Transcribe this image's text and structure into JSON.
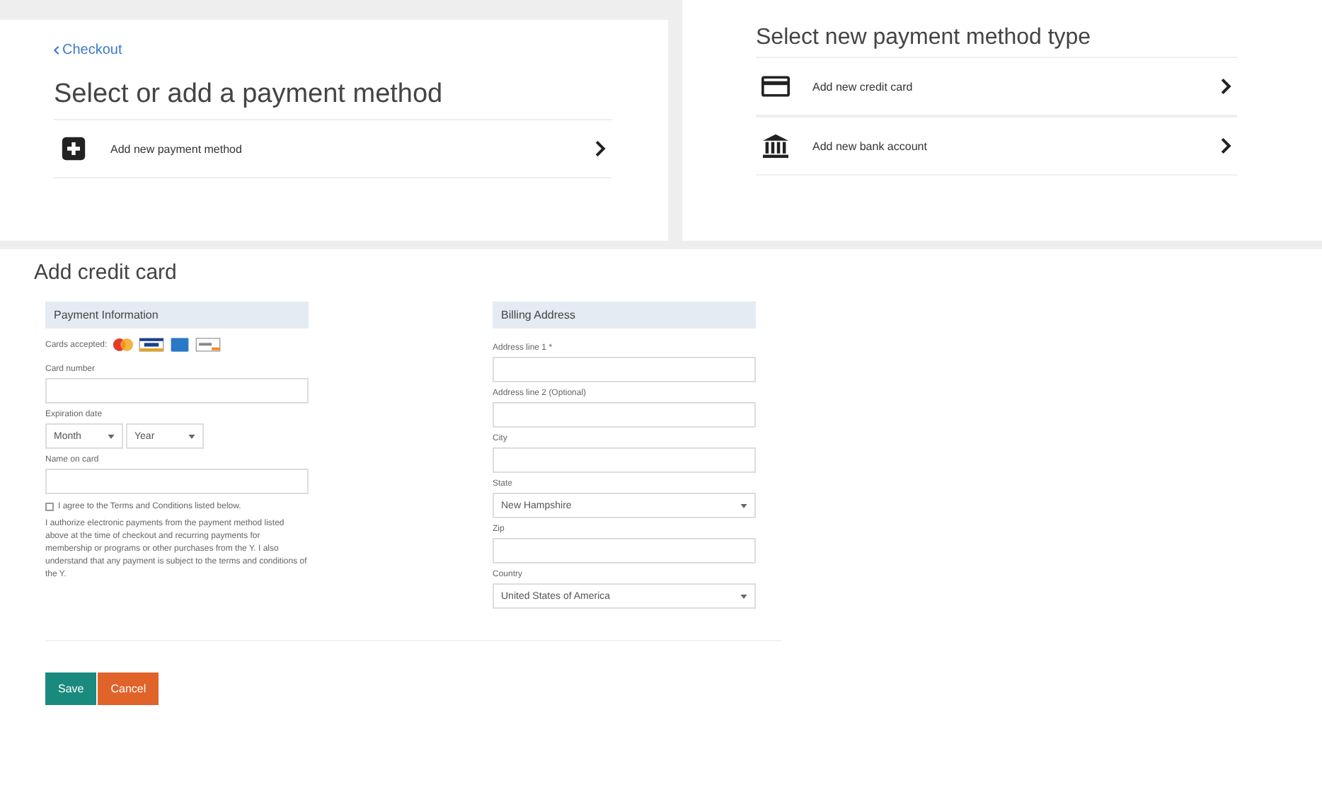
{
  "select_panel": {
    "back_link": "Checkout",
    "title": "Select or add a payment method",
    "items": [
      {
        "label": "Add new payment method",
        "kind": "plus"
      }
    ]
  },
  "type_panel": {
    "title": "Select new payment method type",
    "items": [
      {
        "label": "Add new credit card",
        "kind": "card"
      },
      {
        "label": "Add new bank account",
        "kind": "bank"
      }
    ]
  },
  "credit_card_form": {
    "title": "Add credit card",
    "payment_section": {
      "heading": "Payment Information",
      "cards_label": "Cards accepted:",
      "card_number": {
        "label": "Card number"
      },
      "expiration": {
        "label": "Expiration date",
        "month": "Month",
        "year": "Year"
      },
      "name_on_card": {
        "label": "Name on card"
      },
      "agree": {
        "label": "I agree to the Terms and Conditions listed below.",
        "checked": false
      },
      "terms": "I authorize electronic payments from the payment method listed above at the time of checkout and recurring payments for membership or programs or other purchases from the Y. I also understand that any payment is subject to the terms and conditions of the Y."
    },
    "billing_section": {
      "heading": "Billing Address",
      "fields": [
        {
          "label": "Address line 1 *",
          "kind": "text"
        },
        {
          "label": "Address line 2 (Optional)",
          "kind": "text"
        },
        {
          "label": "City",
          "kind": "text"
        },
        {
          "label": "State",
          "kind": "select",
          "value": "New Hampshire"
        },
        {
          "label": "Zip",
          "kind": "text"
        },
        {
          "label": "Country",
          "kind": "select",
          "value": "United States of America"
        }
      ]
    },
    "buttons": [
      {
        "label": "Save",
        "kind": "primary"
      },
      {
        "label": "Cancel",
        "kind": "danger"
      }
    ]
  }
}
